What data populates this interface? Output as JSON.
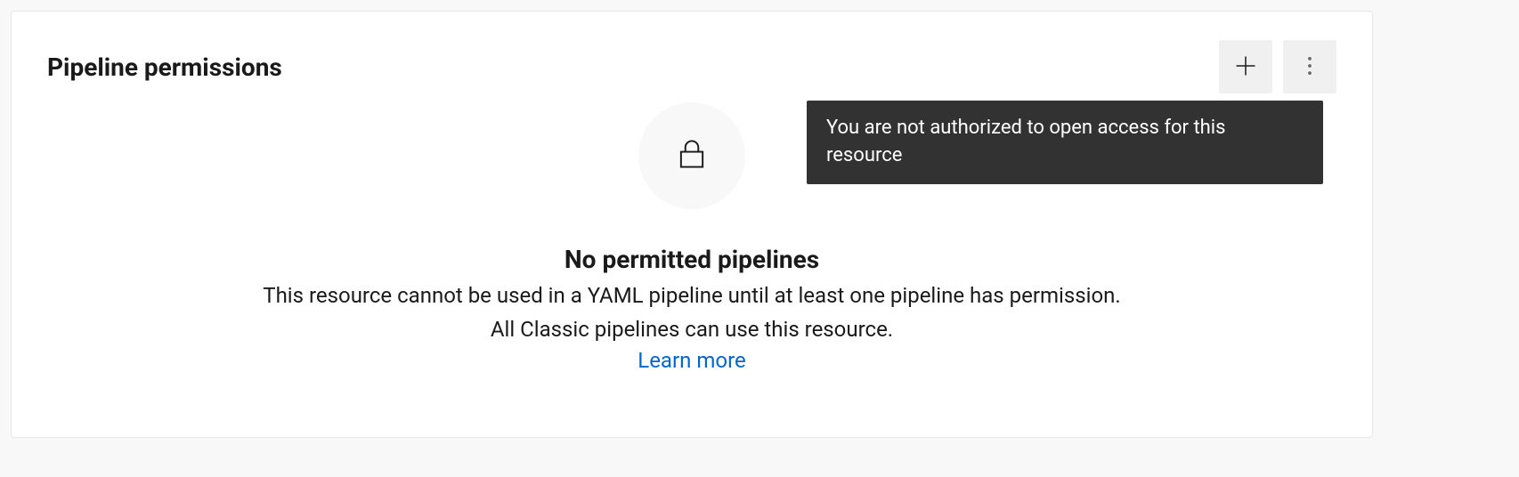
{
  "panel": {
    "title": "Pipeline permissions"
  },
  "actions": {
    "add_icon": "plus-icon",
    "more_icon": "more-vertical-icon"
  },
  "empty_state": {
    "icon": "lock-icon",
    "title": "No permitted pipelines",
    "description_line1": "This resource cannot be used in a YAML pipeline until at least one pipeline has permission.",
    "description_line2": "All Classic pipelines can use this resource.",
    "learn_more_label": "Learn more"
  },
  "tooltip": {
    "text": "You are not authorized to open access for this resource"
  }
}
